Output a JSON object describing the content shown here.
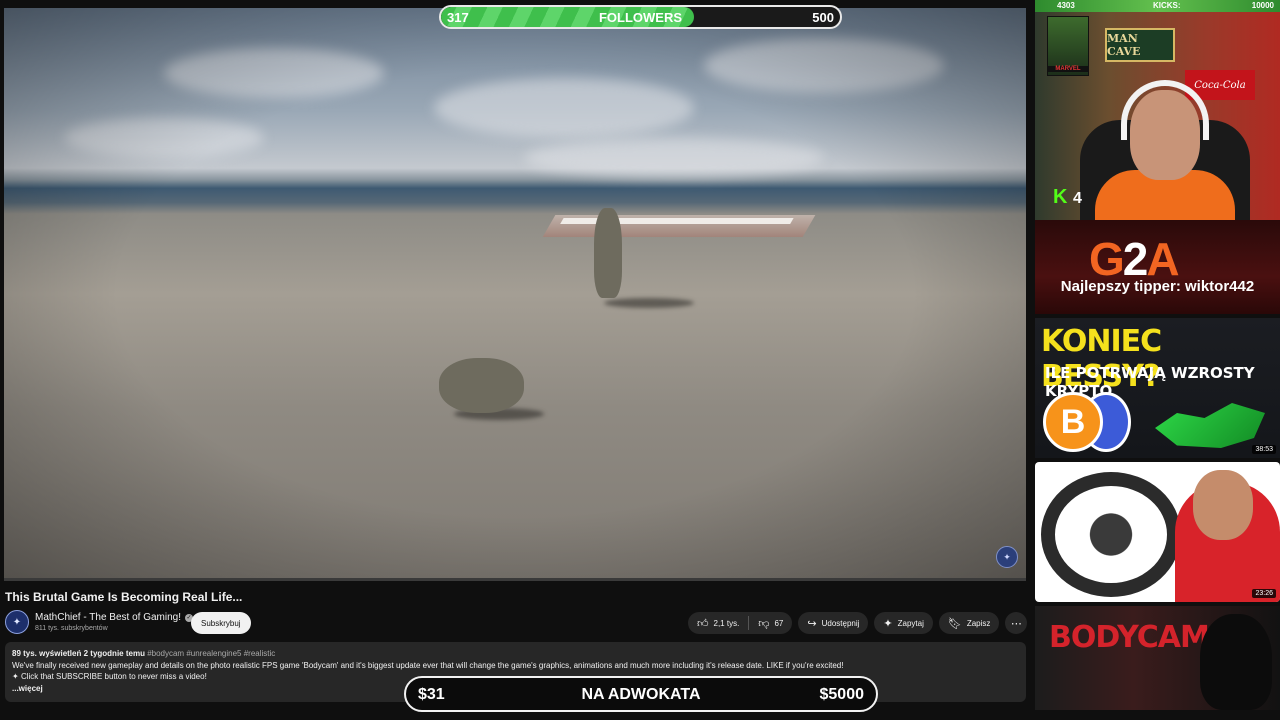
{
  "followers_goal": {
    "current": "317",
    "label": "FOLLOWERS",
    "target": "500",
    "fill_fraction": 0.634
  },
  "video": {
    "title": "This Brutal Game Is Becoming Real Life...",
    "channel_name": "MathChief - The Best of Gaming!",
    "subscribers": "811 tys. subskrybentów",
    "subscribe_label": "Subskrybuj",
    "likes": "2,1 tys.",
    "dislikes": "67",
    "share_label": "Udostępnij",
    "ask_label": "Zapytaj",
    "save_label": "Zapisz",
    "views": "89 tys. wyświetleń",
    "age": "2 tygodnie temu",
    "tags": "#bodycam #unrealengine5 #realistic",
    "description_line1": "We've finally received new gameplay and details on the photo realistic FPS game 'Bodycam' and it's biggest update ever that will change the game's graphics, animations and much more including it's release date. LIKE if you're excited!",
    "description_line2": "Click that SUBSCRIBE button to never miss a video!",
    "more_label": "...więcej"
  },
  "donation_goal": {
    "current": "$31",
    "label": "NA ADWOKATA",
    "target": "$5000"
  },
  "stream_overlay": {
    "left_count": "4303",
    "kicks_label": "KICKS:",
    "kicks_target": "10000",
    "sign_text": "MAN CAVE",
    "poster_text": "MARVEL",
    "cola_text": "Coca-Cola",
    "kick_letter": "K",
    "kick_count": "4"
  },
  "sidebar": {
    "g2a_letters": {
      "g": "G",
      "two": "2",
      "a": "A"
    },
    "tipper": "Najlepszy tipper: wiktor442",
    "thumb1_title": "KONIEC BESSY?",
    "thumb1_subtitle": "ILE POTRWAJĄ WZROSTY KRYPTO",
    "thumb1_coin": "B",
    "thumb1_duration": "38:53",
    "thumb2_duration": "23:26",
    "thumb3_title": "BODYCAM"
  },
  "colors": {
    "kick_green": "#53fc18",
    "follow_green": "#3fbf4c",
    "g2a_orange": "#f26522",
    "crypto_yellow": "#f5e11d"
  }
}
